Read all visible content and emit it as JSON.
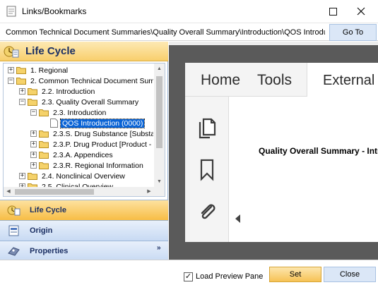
{
  "window": {
    "title": "Links/Bookmarks",
    "maximize_icon": "maximize-icon",
    "close_icon": "close-icon"
  },
  "pathbar": {
    "path": "Common Technical Document Summaries\\Quality Overall Summary\\Introduction\\QOS Introduction",
    "goto_label": "Go To"
  },
  "left_pane": {
    "header_title": "Life Cycle",
    "tree": [
      {
        "label": "1. Regional",
        "depth": 0,
        "expander": "+",
        "icon": "folder"
      },
      {
        "label": "2. Common Technical Document Summ",
        "depth": 0,
        "expander": "−",
        "icon": "folder"
      },
      {
        "label": "2.2. Introduction",
        "depth": 1,
        "expander": "+",
        "icon": "folder"
      },
      {
        "label": "2.3. Quality Overall Summary",
        "depth": 1,
        "expander": "−",
        "icon": "folder"
      },
      {
        "label": "2.3. Introduction",
        "depth": 2,
        "expander": "−",
        "icon": "folder"
      },
      {
        "label": "QOS Introduction (0000)",
        "depth": 3,
        "expander": "",
        "icon": "document",
        "selected": true
      },
      {
        "label": "2.3.S. Drug Substance [Substa",
        "depth": 2,
        "expander": "+",
        "icon": "folder"
      },
      {
        "label": "2.3.P. Drug Product [Product -",
        "depth": 2,
        "expander": "+",
        "icon": "folder"
      },
      {
        "label": "2.3.A. Appendices",
        "depth": 2,
        "expander": "+",
        "icon": "folder"
      },
      {
        "label": "2.3.R. Regional Information",
        "depth": 2,
        "expander": "+",
        "icon": "folder"
      },
      {
        "label": "2.4. Nonclinical Overview",
        "depth": 1,
        "expander": "+",
        "icon": "folder"
      },
      {
        "label": "2.5. Clinical Overview",
        "depth": 1,
        "expander": "+",
        "icon": "folder"
      }
    ],
    "nav_buttons": {
      "life_cycle": "Life Cycle",
      "origin": "Origin",
      "properties": "Properties",
      "more_glyph": "»"
    }
  },
  "preview": {
    "tabs": {
      "home": "Home",
      "tools": "Tools",
      "external": "External"
    },
    "side_icons": [
      "pages-icon",
      "bookmark-icon",
      "attachment-icon"
    ],
    "document_heading": "Quality Overall Summary - Introduction"
  },
  "footer": {
    "load_preview_label": "Load Preview Pane",
    "load_preview_checked": true,
    "set_label": "Set",
    "close_label": "Close"
  },
  "colors": {
    "accent_orange": "#f7bd45",
    "accent_blue": "#c8daf3",
    "selection_blue": "#0a64d6",
    "header_text": "#1b2f63"
  }
}
